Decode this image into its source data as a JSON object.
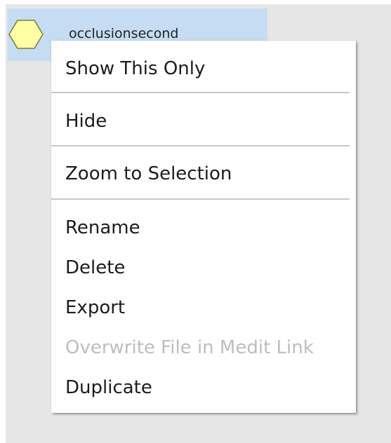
{
  "colors": {
    "panel_background": "#e6e6e6",
    "selection_highlight": "#c5dcf3",
    "hexagon_fill": "#ffffa6",
    "disabled_text": "#bdbdbd"
  },
  "tree": {
    "item": {
      "name": "occlusionsecond",
      "icon": "hexagon-icon"
    }
  },
  "context_menu": {
    "items": [
      {
        "label": "Show This Only",
        "enabled": true
      },
      {
        "label": "Hide",
        "enabled": true
      },
      {
        "label": "Zoom to Selection",
        "enabled": true
      },
      {
        "label": "Rename",
        "enabled": true
      },
      {
        "label": "Delete",
        "enabled": true
      },
      {
        "label": "Export",
        "enabled": true
      },
      {
        "label": "Overwrite File in Medit Link",
        "enabled": false
      },
      {
        "label": "Duplicate",
        "enabled": true
      }
    ]
  }
}
